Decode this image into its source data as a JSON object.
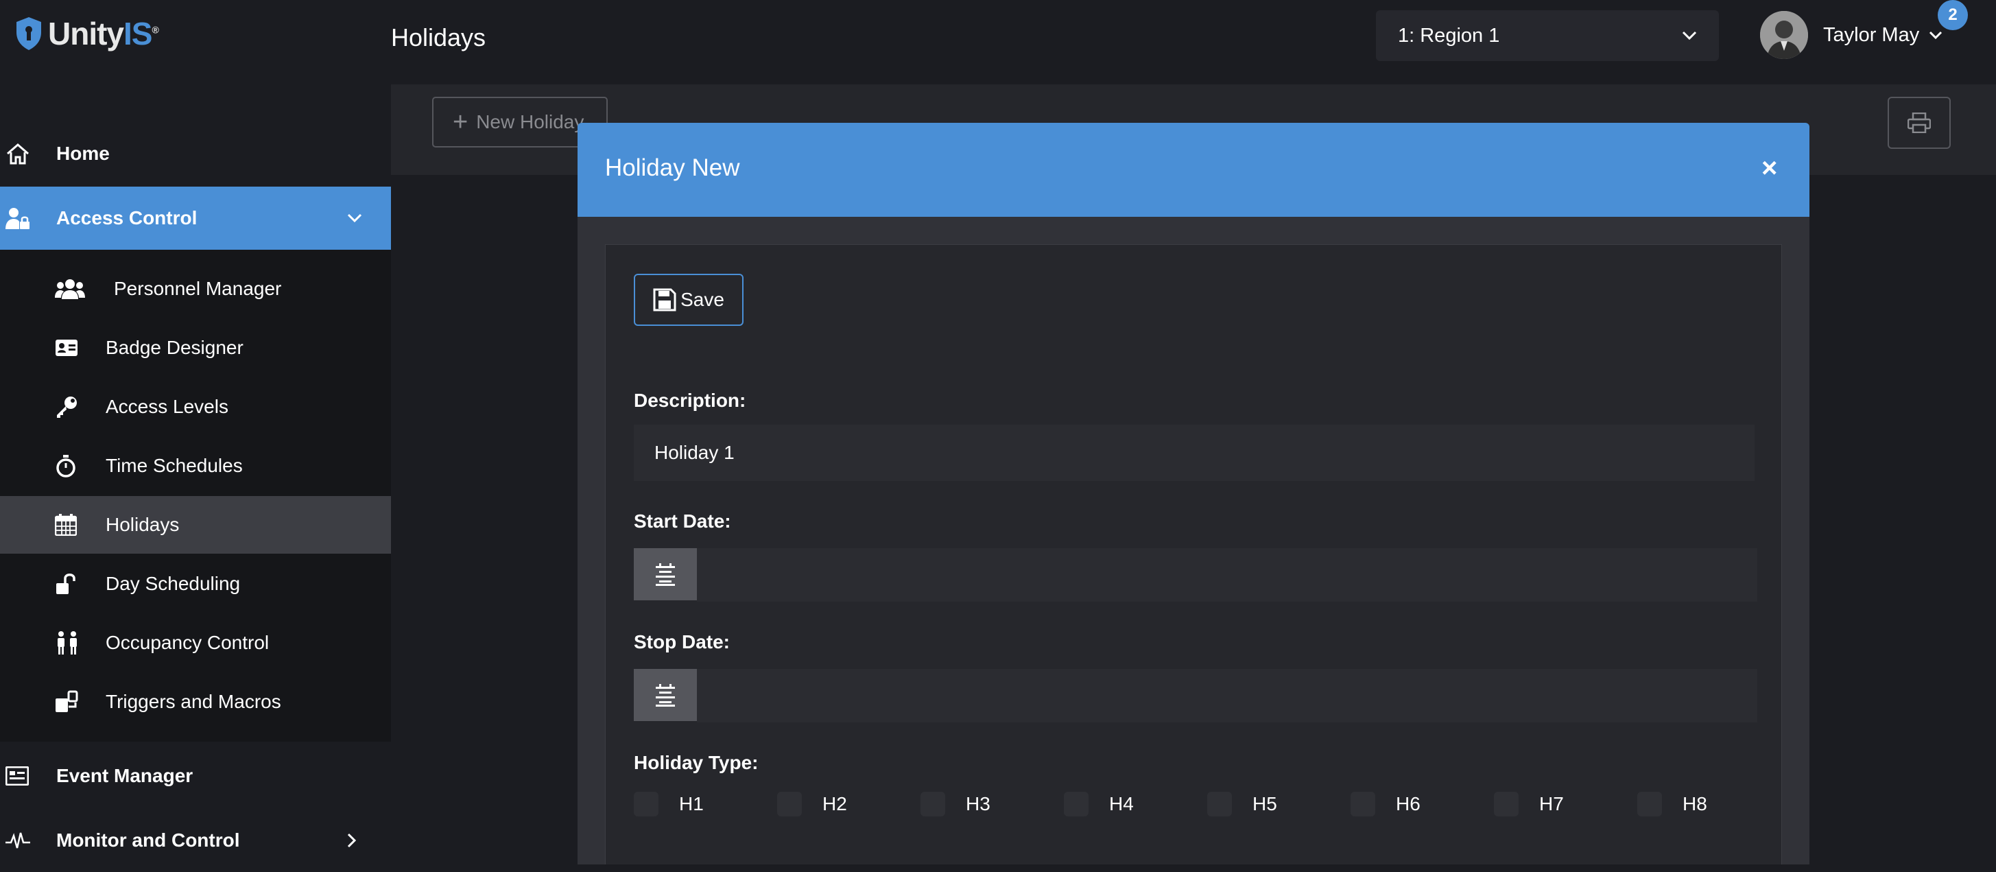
{
  "app": {
    "logo_part1": "Unity",
    "logo_part2": "IS",
    "logo_mark": "®"
  },
  "header": {
    "page_title": "Holidays",
    "region_selected": "1: Region 1",
    "user_name": "Taylor May",
    "notification_count": "2"
  },
  "sidebar": {
    "home": "Home",
    "access_control": "Access Control",
    "sub_items": [
      {
        "label": "Personnel Manager",
        "icon": "people-icon"
      },
      {
        "label": "Badge Designer",
        "icon": "id-card-icon"
      },
      {
        "label": "Access Levels",
        "icon": "key-icon"
      },
      {
        "label": "Time Schedules",
        "icon": "stopwatch-icon"
      },
      {
        "label": "Holidays",
        "icon": "calendar-icon"
      },
      {
        "label": "Day Scheduling",
        "icon": "unlock-icon"
      },
      {
        "label": "Occupancy Control",
        "icon": "persons-icon"
      },
      {
        "label": "Triggers and Macros",
        "icon": "triggers-icon"
      }
    ],
    "event_manager": "Event Manager",
    "monitor_control": "Monitor and Control"
  },
  "toolbar": {
    "new_holiday": "New Holiday"
  },
  "modal": {
    "title": "Holiday New",
    "close": "×",
    "save": "Save",
    "description_label": "Description:",
    "description_value": "Holiday 1",
    "start_date_label": "Start Date:",
    "stop_date_label": "Stop Date:",
    "holiday_type_label": "Holiday Type:",
    "holiday_types": [
      "H1",
      "H2",
      "H3",
      "H4",
      "H5",
      "H6",
      "H7",
      "H8"
    ]
  },
  "colors": {
    "accent": "#4a8fd6",
    "background": "#1b1c21",
    "modal_bg": "#313238",
    "selected_item": "#3d3e44"
  }
}
